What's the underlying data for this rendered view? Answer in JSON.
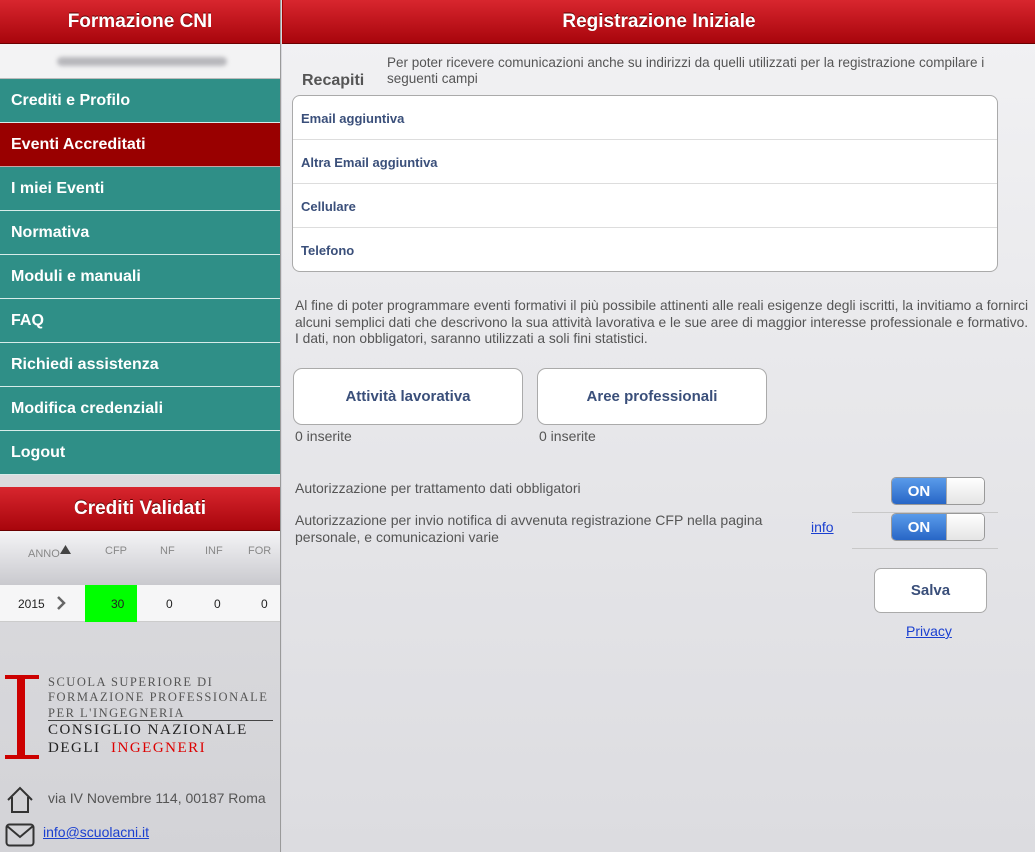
{
  "sidebar": {
    "title": "Formazione CNI",
    "nav": [
      {
        "label": "Crediti e Profilo",
        "active": false
      },
      {
        "label": "Eventi Accreditati",
        "active": true
      },
      {
        "label": "I miei Eventi",
        "active": false
      },
      {
        "label": "Normativa",
        "active": false
      },
      {
        "label": "Moduli e manuali",
        "active": false
      },
      {
        "label": "FAQ",
        "active": false
      },
      {
        "label": "Richiedi assistenza",
        "active": false
      },
      {
        "label": "Modifica credenziali",
        "active": false
      },
      {
        "label": "Logout",
        "active": false
      }
    ],
    "credits": {
      "title": "Crediti Validati",
      "headers": {
        "anno": "ANNO",
        "cfp": "CFP",
        "nf": "NF",
        "inf": "INF",
        "for": "FOR"
      },
      "row": {
        "anno": "2015",
        "cfp": "30",
        "nf": "0",
        "inf": "0",
        "for": "0"
      },
      "highlight_color": "#00ff00"
    },
    "logo": {
      "letter": "I",
      "line1": "SCUOLA SUPERIORE DI",
      "line2": "FORMAZIONE PROFESSIONALE",
      "line3": "PER L'INGEGNERIA",
      "line4": "CONSIGLIO NAZIONALE",
      "line5a": "DEGLI",
      "line5b": "INGEGNERI"
    },
    "address": "via IV Novembre 114, 00187 Roma",
    "email": "info@scuolacni.it"
  },
  "main": {
    "title": "Registrazione Iniziale",
    "recapiti_label": "Recapiti",
    "recapiti_intro": "Per poter ricevere comunicazioni anche su indirizzi da quelli utilizzati per la registrazione compilare i seguenti campi",
    "fields": [
      {
        "label": "Email aggiuntiva",
        "value": ""
      },
      {
        "label": "Altra Email aggiuntiva",
        "value": ""
      },
      {
        "label": "Cellulare",
        "value": ""
      },
      {
        "label": "Telefono",
        "value": ""
      }
    ],
    "info_text": "Al fine di poter programmare eventi formativi il più possibile attinenti alle reali esigenze degli iscritti, la invitiamo a fornirci alcuni semplici dati che descrivono la sua attività lavorativa e le sue aree di maggior interesse professionale e formativo. I dati, non obbligatori, saranno utilizzati a soli fini statistici.",
    "activity_button": "Attività lavorativa",
    "activity_count": "0 inserite",
    "areas_button": "Aree professionali",
    "areas_count": "0 inserite",
    "auth1": "Autorizzazione per trattamento dati obbligatori",
    "auth1_toggle": "ON",
    "auth2": "Autorizzazione per invio notifica di avvenuta registrazione CFP nella pagina personale, e comunicazioni varie",
    "auth2_toggle": "ON",
    "info_link": "info",
    "save_button": "Salva",
    "privacy_link": "Privacy",
    "colors": {
      "header_red": "#c0141c",
      "nav_teal": "#2f8f87",
      "nav_active": "#990000",
      "toggle_blue": "#3a7fd8"
    }
  }
}
